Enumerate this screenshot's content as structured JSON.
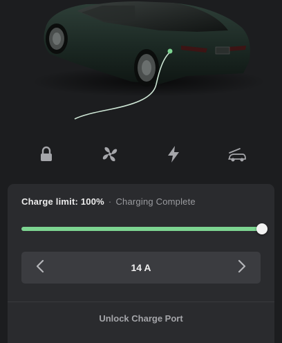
{
  "vehicle": {
    "image_alt": "Model S charging"
  },
  "quick_controls": [
    {
      "name": "lock-icon"
    },
    {
      "name": "fan-icon"
    },
    {
      "name": "lightning-bolt-icon"
    },
    {
      "name": "frunk-icon"
    }
  ],
  "charge_panel": {
    "limit_label": "Charge limit: 100%",
    "separator": "·",
    "state_label": "Charging Complete",
    "charge_limit_fraction": 1.0,
    "amperage": "14 A",
    "unlock_label": "Unlock Charge Port"
  },
  "colors": {
    "background": "#1c1d1f",
    "panel": "#2a2b2e",
    "accent_green": "#7dd491",
    "car_body": "#1d2a25"
  }
}
